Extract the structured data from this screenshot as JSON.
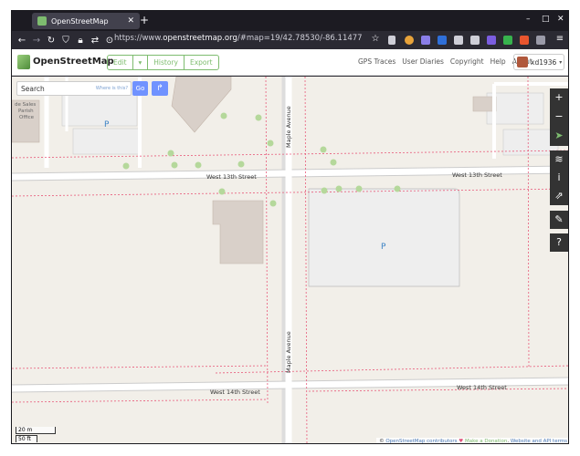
{
  "browser": {
    "tab_title": "OpenStreetMap",
    "url_prefix": "https://www.",
    "url_domain": "openstreetmap.org",
    "url_rest": "/#map=19/42.78530/-86.11477"
  },
  "osm": {
    "brand": "OpenStreetMap",
    "edit_label": "Edit",
    "history_label": "History",
    "export_label": "Export",
    "links": [
      "GPS Traces",
      "User Diaries",
      "Copyright",
      "Help",
      "About"
    ],
    "username": "xd1936"
  },
  "search": {
    "placeholder": "Search",
    "where_is_this": "Where is this?",
    "go_label": "Go"
  },
  "map": {
    "streets": {
      "west13": "West 13th Street",
      "west14": "West 14th Street",
      "maple": "Maple Avenue"
    },
    "parking_symbol": "P",
    "poi_label": [
      "de Sales",
      "Parish",
      "Office"
    ],
    "scale_metric": "20 m",
    "scale_imperial": "50 ft",
    "attribution": {
      "copy": "©",
      "contributors": "OpenStreetMap contributors",
      "heart": "♥",
      "donation": "Make a Donation",
      "dot": ".",
      "terms": "Website and API terms"
    },
    "colors": {
      "land": "#f2efe9",
      "building": "#d9d0c9",
      "parking": "#eeeeee",
      "tree": "#b5d89b",
      "road": "#ffffff",
      "boundary": "#e85a7a"
    }
  },
  "map_controls": [
    "zoom-in",
    "zoom-out",
    "locate",
    "layers",
    "info",
    "share",
    "note",
    "query"
  ]
}
